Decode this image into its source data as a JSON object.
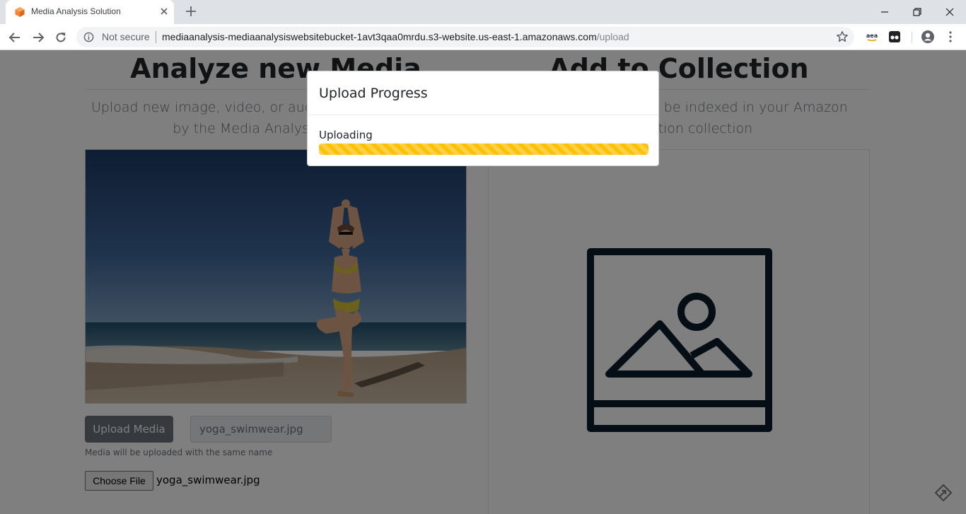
{
  "browser": {
    "tab_title": "Media Analysis Solution",
    "security_label": "Not secure",
    "url_host": "mediaanalysis-mediaanalysiswebsitebucket-1avt3qaa0mrdu.s3-website.us-east-1.amazonaws.com",
    "url_path": "/upload",
    "icons": {
      "favicon": "aws-hexagon-icon",
      "close_tab": "close-icon",
      "new_tab": "plus-icon",
      "back": "arrow-left-icon",
      "forward": "arrow-right-icon",
      "reload": "reload-icon",
      "info": "info-icon",
      "bookmark": "star-icon",
      "extension_1": "amazon-assistant-icon",
      "extension_2": "extension-icon",
      "profile": "account-icon",
      "menu": "kebab-menu-icon"
    }
  },
  "left_panel": {
    "title": "Analyze new Media",
    "description": "Upload new image, video, or audio files to be analyzed by the Media Analysis Solution",
    "upload_button": "Upload Media",
    "filename_value": "yoga_swimwear.jpg",
    "help_text": "Media will be uploaded with the same name",
    "choose_file_button": "Choose File",
    "chosen_file": "yoga_swimwear.jpg"
  },
  "right_panel": {
    "title": "Add to Collection",
    "description": "Upload new images to be indexed in your Amazon Rekognition collection",
    "placeholder_icon": "image-placeholder-icon"
  },
  "modal": {
    "title": "Upload Progress",
    "status": "Uploading",
    "progress_percent": 100,
    "progress_color": "#ffc107"
  },
  "colors": {
    "chrome_bg": "#dee1e6",
    "overlay": "rgba(0,0,0,0.5)",
    "button_gray": "#6c757d"
  }
}
